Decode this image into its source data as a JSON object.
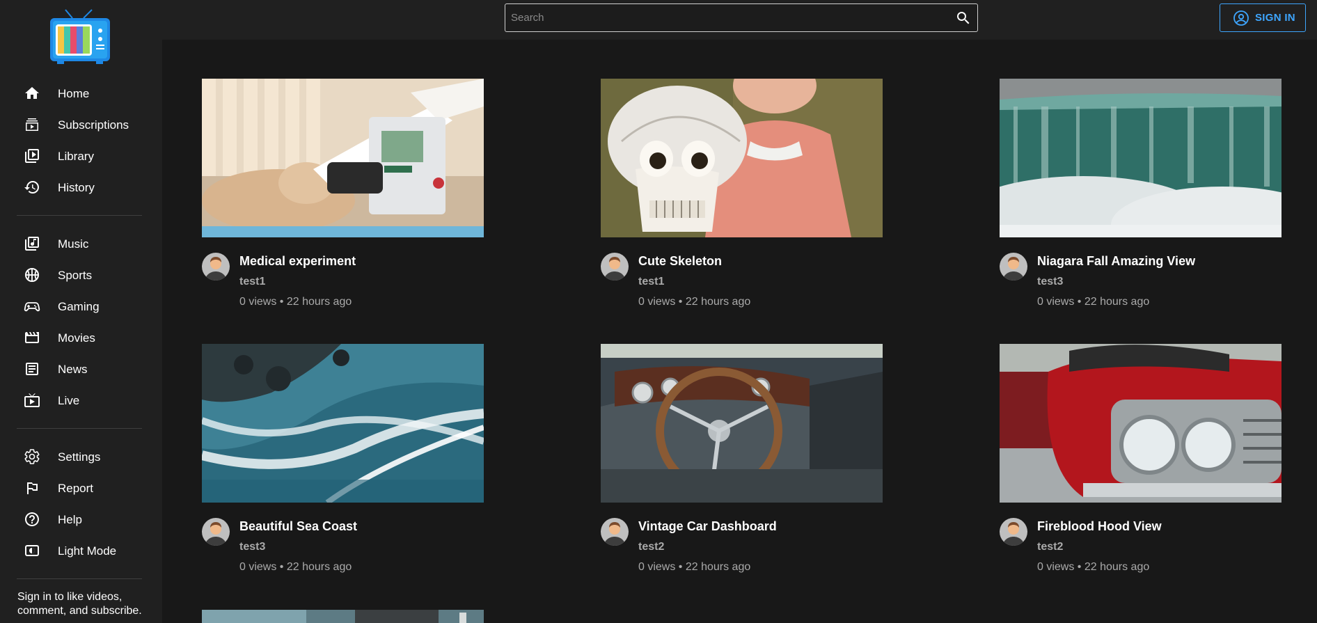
{
  "header": {
    "search_placeholder": "Search",
    "signin_label": "SIGN IN",
    "accent_color": "#3ea6ff"
  },
  "sidebar": {
    "logo_icon": "retro-tv-icon",
    "items": [
      {
        "label": "Home",
        "icon": "home-icon"
      },
      {
        "label": "Subscriptions",
        "icon": "subscriptions-icon"
      },
      {
        "label": "Library",
        "icon": "library-icon"
      },
      {
        "label": "History",
        "icon": "history-icon"
      },
      {
        "label": "Music",
        "icon": "music-icon"
      },
      {
        "label": "Sports",
        "icon": "sports-icon"
      },
      {
        "label": "Gaming",
        "icon": "gaming-icon"
      },
      {
        "label": "Movies",
        "icon": "movies-icon"
      },
      {
        "label": "News",
        "icon": "news-icon"
      },
      {
        "label": "Live",
        "icon": "live-icon"
      },
      {
        "label": "Settings",
        "icon": "settings-icon"
      },
      {
        "label": "Report",
        "icon": "report-icon"
      },
      {
        "label": "Help",
        "icon": "help-icon"
      },
      {
        "label": "Light Mode",
        "icon": "light-mode-icon"
      }
    ],
    "signin_note": "Sign in to like videos, comment, and subscribe."
  },
  "videos": [
    {
      "title": "Medical experiment",
      "channel": "test1",
      "meta": "0 views • 22 hours ago"
    },
    {
      "title": "Cute Skeleton",
      "channel": "test1",
      "meta": "0 views • 22 hours ago"
    },
    {
      "title": "Niagara Fall Amazing View",
      "channel": "test3",
      "meta": "0 views • 22 hours ago"
    },
    {
      "title": "Beautiful Sea Coast",
      "channel": "test3",
      "meta": "0 views • 22 hours ago"
    },
    {
      "title": "Vintage Car Dashboard",
      "channel": "test2",
      "meta": "0 views • 22 hours ago"
    },
    {
      "title": "Fireblood Hood View",
      "channel": "test2",
      "meta": "0 views • 22 hours ago"
    }
  ]
}
